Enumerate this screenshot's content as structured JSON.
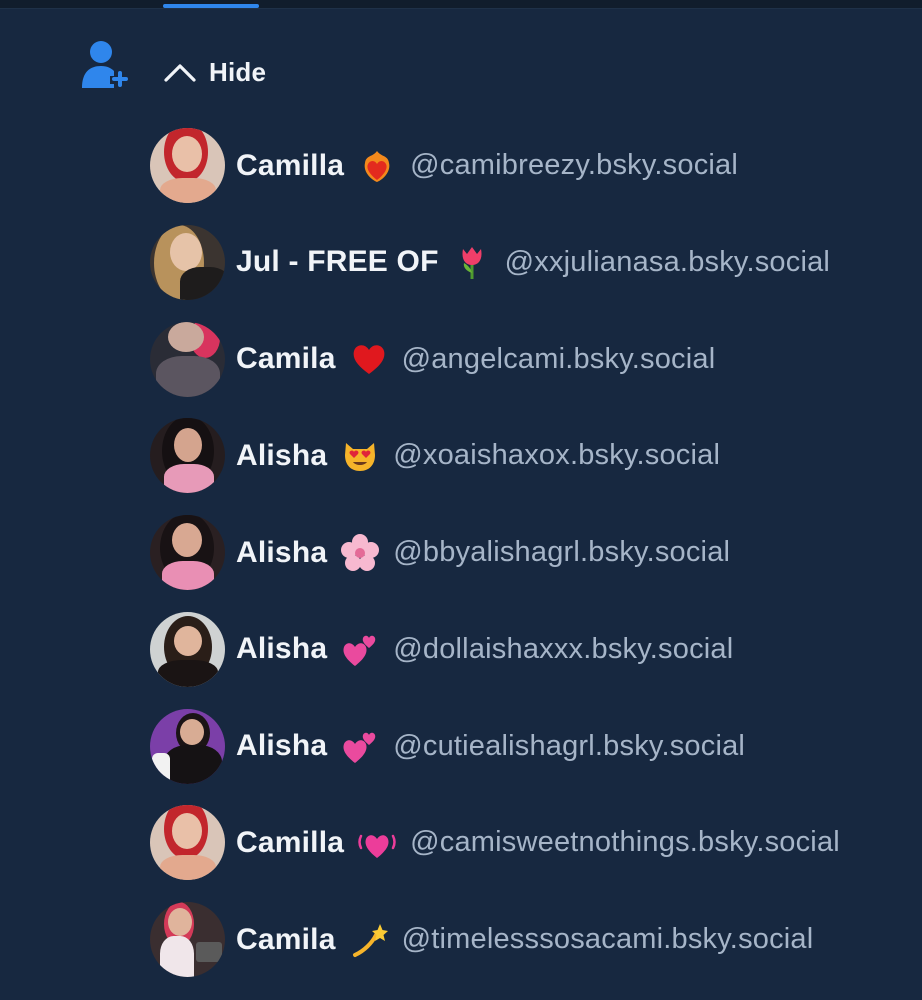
{
  "header": {
    "hide_label": "Hide",
    "follow_icon": "person-add-icon",
    "toggle_icon": "chevron-up-icon",
    "accent_color": "#2f86ec",
    "background_color": "#172840"
  },
  "suggestions": [
    {
      "name": "Camilla",
      "emoji": "heart-on-fire",
      "emoji_char": "❤️‍🔥",
      "handle": "@camibreezy.bsky.social"
    },
    {
      "name": "Jul - FREE OF",
      "emoji": "tulip",
      "emoji_char": "🌷",
      "handle": "@xxjulianasa.bsky.social"
    },
    {
      "name": "Camila",
      "emoji": "red-heart",
      "emoji_char": "❤️",
      "handle": "@angelcami.bsky.social"
    },
    {
      "name": "Alisha",
      "emoji": "heart-eyes-cat",
      "emoji_char": "😻",
      "handle": "@xoaishaxox.bsky.social"
    },
    {
      "name": "Alisha",
      "emoji": "cherry-blossom",
      "emoji_char": "🌸",
      "handle": "@bbyalishagrl.bsky.social"
    },
    {
      "name": "Alisha",
      "emoji": "two-hearts",
      "emoji_char": "💕",
      "handle": "@dollaishaxxx.bsky.social"
    },
    {
      "name": "Alisha",
      "emoji": "two-hearts",
      "emoji_char": "💕",
      "handle": "@cutiealishagrl.bsky.social"
    },
    {
      "name": "Camilla",
      "emoji": "beating-heart",
      "emoji_char": "💓",
      "handle": "@camisweetnothings.bsky.social"
    },
    {
      "name": "Camila",
      "emoji": "dizzy",
      "emoji_char": "💫",
      "handle": "@timelesssosacami.bsky.social"
    }
  ]
}
